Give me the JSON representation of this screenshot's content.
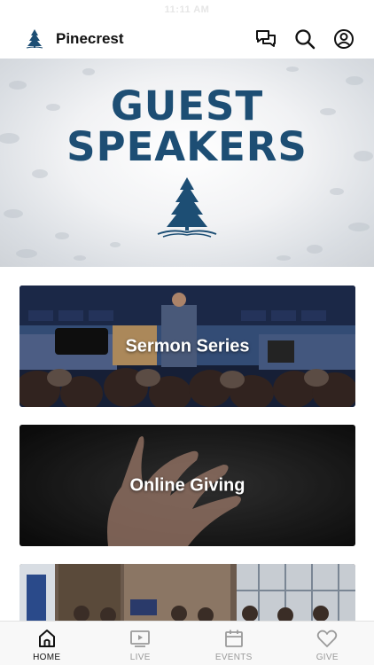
{
  "status_bar": {
    "time": "11:11 AM"
  },
  "header": {
    "title": "Pinecrest",
    "icons": [
      "chat-bubbles-icon",
      "search-icon",
      "profile-icon"
    ]
  },
  "hero": {
    "line1": "GUEST",
    "line2": "SPEAKERS"
  },
  "cards": [
    {
      "label": "Sermon Series"
    },
    {
      "label": "Online Giving"
    },
    {
      "label": ""
    }
  ],
  "tabs": [
    {
      "label": "HOME",
      "icon": "home-icon",
      "active": true
    },
    {
      "label": "LIVE",
      "icon": "play-screen-icon",
      "active": false
    },
    {
      "label": "EVENTS",
      "icon": "calendar-icon",
      "active": false
    },
    {
      "label": "GIVE",
      "icon": "heart-icon",
      "active": false
    }
  ],
  "colors": {
    "brand": "#1d4e74",
    "active_tab": "#111111",
    "inactive_tab": "#9a9a9a"
  }
}
